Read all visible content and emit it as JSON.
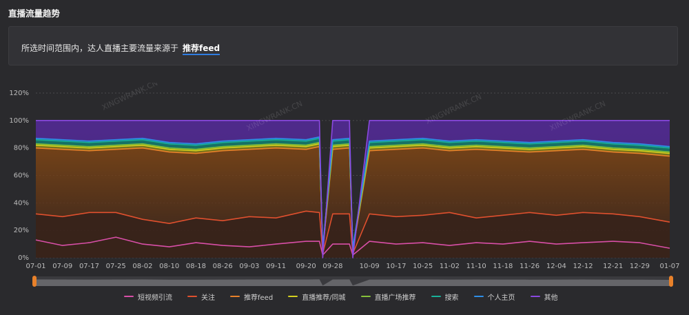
{
  "page": {
    "title": "直播流量趋势"
  },
  "insight": {
    "text": "所选时间范围内，达人直播主要流量来源于",
    "highlight": "推荐feed"
  },
  "colors": {
    "background": "#2a2a2d",
    "短视频引流": "#d94fa8",
    "关注": "#e0502e",
    "推荐feed": "#e8812a",
    "直播推荐/同城": "#d6d21f",
    "直播广场推荐": "#86c23a",
    "搜索": "#19b29a",
    "个人主页": "#2f8fe8",
    "其他": "#8a49e0"
  },
  "watermark_text": "XINGWRANK.CN",
  "chart_data": {
    "type": "area",
    "stacked": true,
    "grid": true,
    "legend_position": "bottom",
    "y_tick_labels": [
      "0%",
      "20%",
      "40%",
      "60%",
      "80%",
      "100%",
      "120%"
    ],
    "ylim": [
      0,
      120
    ],
    "x_tick_labels": [
      "07-01",
      "07-09",
      "07-17",
      "07-25",
      "08-02",
      "08-10",
      "08-18",
      "08-26",
      "09-03",
      "09-11",
      "09-20",
      "09-28",
      "10-09",
      "10-17",
      "10-25",
      "11-02",
      "11-10",
      "11-18",
      "11-26",
      "12-04",
      "12-12",
      "12-21",
      "12-29",
      "01-07"
    ],
    "x_tick_dates": [
      "2023-07-01",
      "2023-07-09",
      "2023-07-17",
      "2023-07-25",
      "2023-08-02",
      "2023-08-10",
      "2023-08-18",
      "2023-08-26",
      "2023-09-03",
      "2023-09-11",
      "2023-09-20",
      "2023-09-28",
      "2023-10-09",
      "2023-10-17",
      "2023-10-25",
      "2023-11-02",
      "2023-11-10",
      "2023-11-18",
      "2023-11-26",
      "2023-12-04",
      "2023-12-12",
      "2023-12-21",
      "2023-12-29",
      "2024-01-07"
    ],
    "sampled_dates": [
      "2023-07-01",
      "2023-07-09",
      "2023-07-17",
      "2023-07-25",
      "2023-08-02",
      "2023-08-10",
      "2023-08-18",
      "2023-08-26",
      "2023-09-03",
      "2023-09-11",
      "2023-09-20",
      "2023-09-24",
      "2023-09-25",
      "2023-09-28",
      "2023-10-03",
      "2023-10-04",
      "2023-10-09",
      "2023-10-17",
      "2023-10-25",
      "2023-11-02",
      "2023-11-10",
      "2023-11-18",
      "2023-11-26",
      "2023-12-04",
      "2023-12-12",
      "2023-12-21",
      "2023-12-29",
      "2024-01-07"
    ],
    "series": [
      {
        "name": "短视频引流",
        "values": [
          13,
          9,
          11,
          15,
          10,
          8,
          11,
          9,
          8,
          10,
          12,
          12,
          2,
          10,
          10,
          2,
          12,
          10,
          11,
          9,
          11,
          10,
          12,
          10,
          11,
          12,
          11,
          7
        ]
      },
      {
        "name": "关注",
        "values": [
          32,
          30,
          33,
          33,
          28,
          25,
          29,
          27,
          30,
          29,
          34,
          33,
          3,
          32,
          32,
          3,
          32,
          30,
          31,
          33,
          29,
          31,
          33,
          31,
          33,
          32,
          30,
          26
        ]
      },
      {
        "name": "推荐feed",
        "values": [
          80,
          79,
          78,
          79,
          80,
          77,
          76,
          78,
          79,
          80,
          79,
          81,
          5,
          79,
          80,
          5,
          78,
          79,
          80,
          78,
          79,
          78,
          77,
          78,
          79,
          77,
          76,
          74
        ]
      },
      {
        "name": "直播推荐/同城",
        "values": [
          82,
          81,
          80,
          81,
          82,
          79,
          78,
          80,
          81,
          82,
          81,
          83,
          6,
          81,
          82,
          6,
          80,
          81,
          82,
          80,
          81,
          80,
          79,
          80,
          81,
          79,
          78,
          76
        ]
      },
      {
        "name": "直播广场推荐",
        "values": [
          83,
          82,
          81,
          82,
          83,
          80,
          79,
          81,
          82,
          83,
          82,
          84,
          6,
          82,
          83,
          6,
          81,
          82,
          83,
          81,
          82,
          81,
          80,
          81,
          82,
          80,
          79,
          77
        ]
      },
      {
        "name": "搜索",
        "values": [
          86,
          85,
          84,
          85,
          86,
          83,
          82,
          84,
          85,
          86,
          85,
          87,
          7,
          85,
          86,
          7,
          84,
          85,
          86,
          84,
          85,
          84,
          83,
          84,
          85,
          83,
          82,
          80
        ]
      },
      {
        "name": "个人主页",
        "values": [
          87,
          86,
          85,
          86,
          87,
          84,
          83,
          85,
          86,
          87,
          86,
          88,
          7,
          86,
          87,
          7,
          85,
          86,
          87,
          85,
          86,
          85,
          84,
          85,
          86,
          84,
          83,
          81
        ]
      },
      {
        "name": "其他",
        "values": [
          100,
          100,
          100,
          100,
          100,
          100,
          100,
          100,
          100,
          100,
          100,
          100,
          0,
          100,
          100,
          0,
          100,
          100,
          100,
          100,
          100,
          100,
          100,
          100,
          100,
          100,
          100,
          100
        ]
      }
    ]
  }
}
